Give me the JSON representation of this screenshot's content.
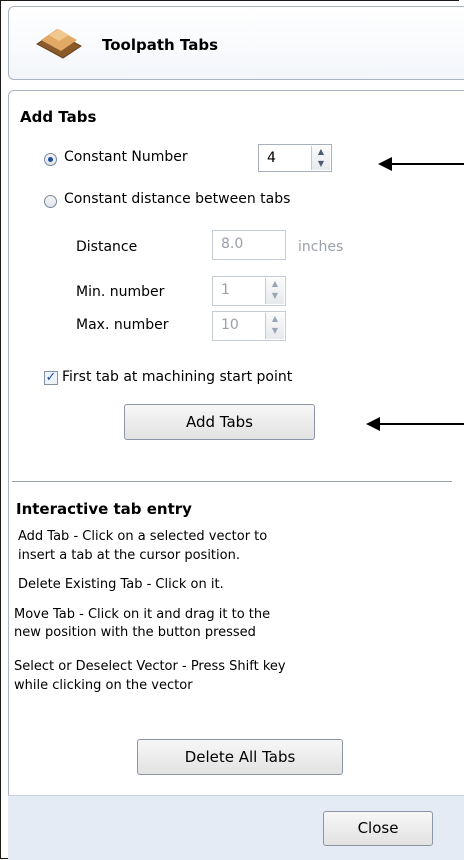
{
  "header": {
    "title": "Toolpath Tabs"
  },
  "add_tabs": {
    "heading": "Add Tabs",
    "constant_number": {
      "label": "Constant Number",
      "value": "4",
      "selected": true
    },
    "constant_distance": {
      "label": "Constant distance between tabs",
      "selected": false
    },
    "distance": {
      "label": "Distance",
      "value": "8.0",
      "unit": "inches"
    },
    "min_number": {
      "label": "Min. number",
      "value": "1"
    },
    "max_number": {
      "label": "Max. number",
      "value": "10"
    },
    "first_tab": {
      "label": "First tab at machining start point",
      "checked": true
    },
    "button": "Add Tabs"
  },
  "interactive": {
    "heading": "Interactive tab entry",
    "line1a": "Add Tab - Click on a selected vector to",
    "line1b": "insert a tab at the cursor position.",
    "line2": "Delete Existing Tab - Click on it.",
    "line3a": "Move Tab - Click on it and drag it to the",
    "line3b": "new position with the button pressed",
    "line4a": "Select or Deselect Vector - Press Shift key",
    "line4b": "while clicking on the vector",
    "delete_button": "Delete All Tabs"
  },
  "footer": {
    "close_button": "Close"
  },
  "icons": {
    "spin_up": "▲",
    "spin_down": "▼",
    "check": "✓"
  }
}
